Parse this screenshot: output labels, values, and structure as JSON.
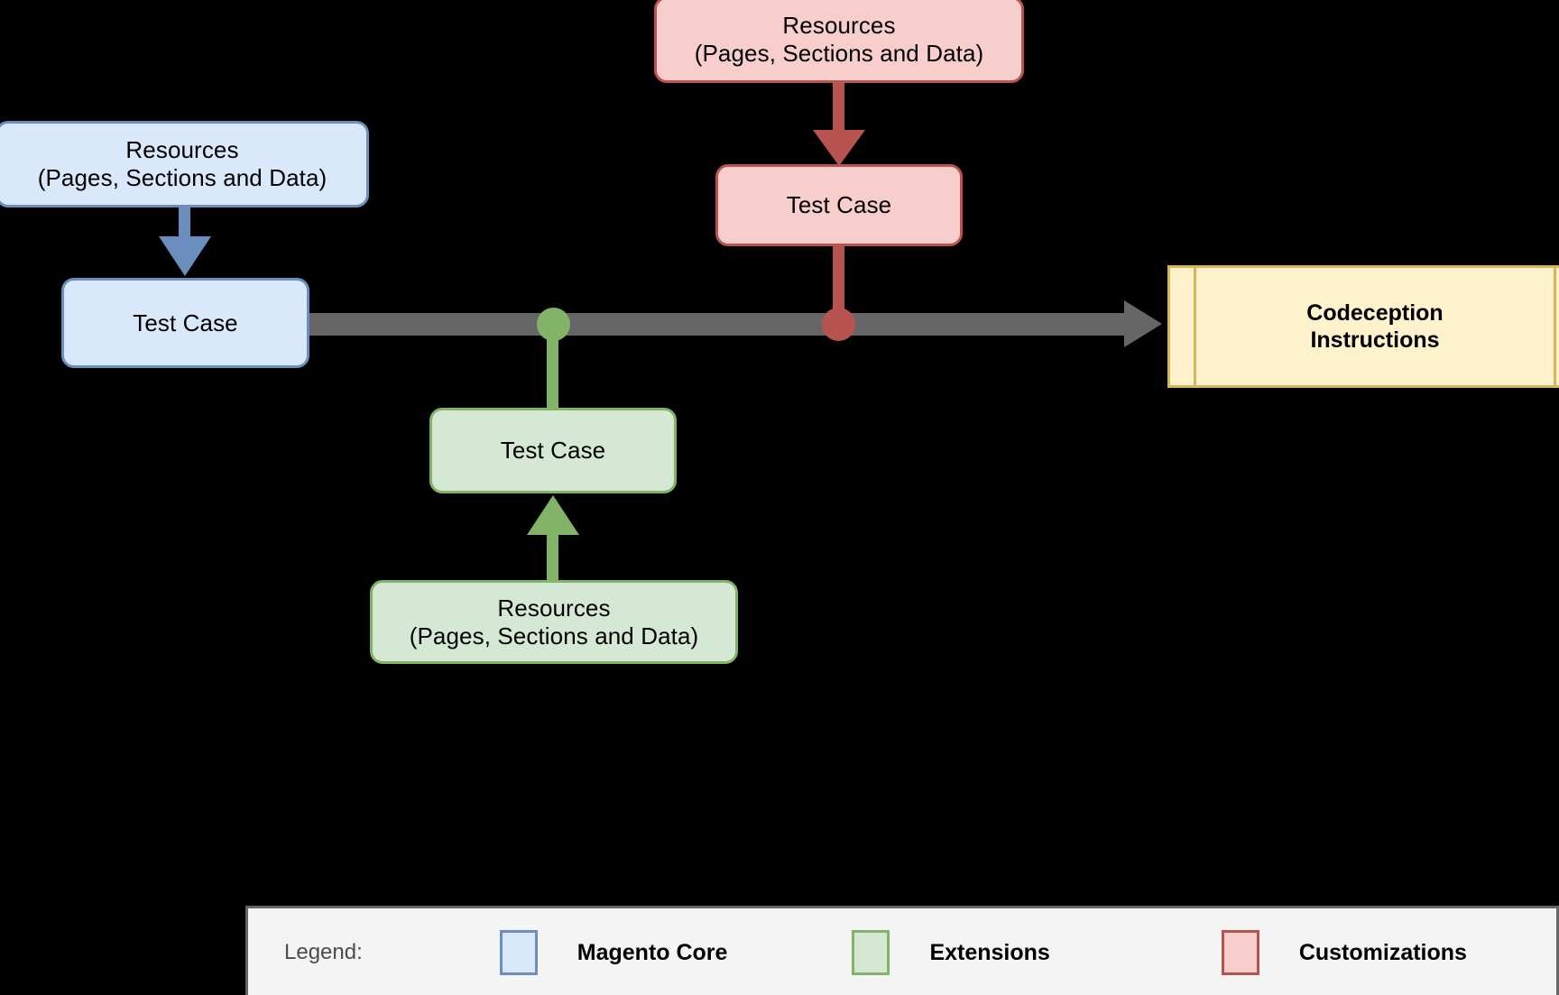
{
  "diagram": {
    "nodes": {
      "core_resources": {
        "text": "Resources\n(Pages, Sections and Data)",
        "group": "Magento Core",
        "fill": "#dae8fc",
        "stroke": "#6c8ebf"
      },
      "core_test_case": {
        "text": "Test Case",
        "group": "Magento Core",
        "fill": "#dae8fc",
        "stroke": "#6c8ebf"
      },
      "custom_resources": {
        "text": "Resources\n(Pages, Sections and Data)",
        "group": "Customizations",
        "fill": "#f8cecc",
        "stroke": "#b85450"
      },
      "custom_test_case": {
        "text": "Test Case",
        "group": "Customizations",
        "fill": "#f8cecc",
        "stroke": "#b85450"
      },
      "ext_test_case": {
        "text": "Test Case",
        "group": "Extensions",
        "fill": "#d5e8d4",
        "stroke": "#82b366"
      },
      "ext_resources": {
        "text": "Resources\n(Pages, Sections and Data)",
        "group": "Extensions",
        "fill": "#d5e8d4",
        "stroke": "#82b366"
      },
      "codeception": {
        "text": "Codeception\nInstructions",
        "fill": "#fff2cc",
        "stroke": "#d6b656"
      }
    },
    "flow_color": "#666666"
  },
  "legend": {
    "title": "Legend:",
    "items": [
      {
        "label": "Magento Core",
        "fill": "#dae8fc",
        "stroke": "#6c8ebf"
      },
      {
        "label": "Extensions",
        "fill": "#d5e8d4",
        "stroke": "#82b366"
      },
      {
        "label": "Customizations",
        "fill": "#f8cecc",
        "stroke": "#b85450"
      }
    ]
  }
}
